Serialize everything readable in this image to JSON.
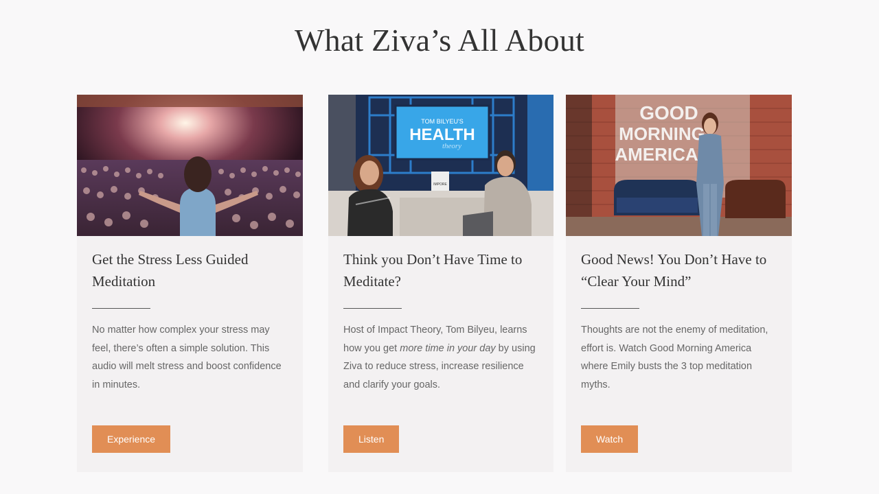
{
  "section": {
    "title": "What Ziva’s All About"
  },
  "cards": [
    {
      "title": "Get the Stress Less Guided Meditation",
      "body": "No matter how complex your stress may feel, there’s often a simple solution. This audio will melt stress and boost confidence in minutes.",
      "button": "Experience"
    },
    {
      "title": "Think you Don’t Have Time to Meditate?",
      "body_before": "Host of Impact Theory, Tom Bilyeu, learns how you get ",
      "body_emphasis": "more time in your day",
      "body_after": " by using Ziva to reduce stress, increase resilience and clarify your goals.",
      "button": "Listen",
      "image_sign": {
        "line1": "TOM BILYEU'S",
        "line2": "HEALTH",
        "line3": "theory",
        "badge": "IMPORE"
      }
    },
    {
      "title": "Good News! You Don’t Have to “Clear Your Mind”",
      "body": "Thoughts are not the enemy of meditation, effort is. Watch Good Morning America where Emily busts the 3 top meditation myths.",
      "button": "Watch",
      "image_sign": {
        "line1": "GOOD",
        "line2": "MORNING",
        "line3": "AMERICA"
      }
    }
  ]
}
